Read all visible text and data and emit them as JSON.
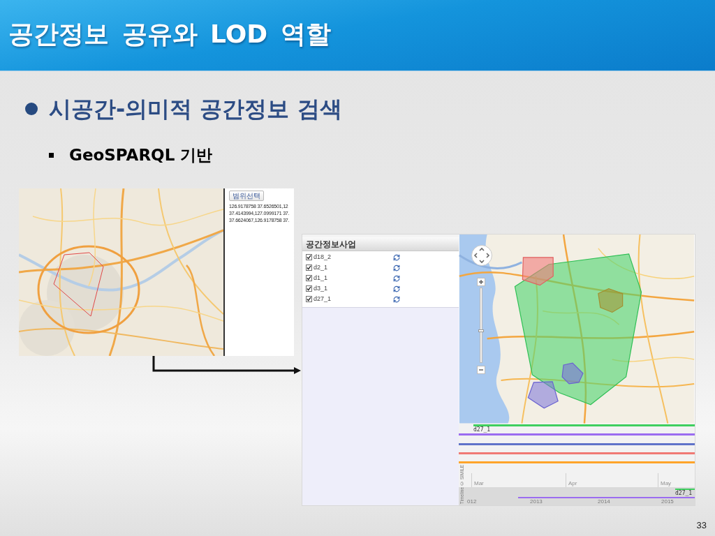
{
  "slide": {
    "title": "공간정보 공유와 LOD 역할",
    "page_number": "33"
  },
  "bullets": [
    {
      "text": "시공간-의미적 공간정보 검색",
      "children": [
        {
          "text": "GeoSPARQL 기반"
        }
      ]
    }
  ],
  "screenshot_1": {
    "button": "범위선택",
    "coordinates": [
      "126.9178758 37.6526501,12",
      "37.4143994,127.0999171 37.",
      "37.6624067,126.9178758 37."
    ]
  },
  "screenshot_2": {
    "panel_title": "공간정보사업",
    "layers": [
      {
        "label": "d18_2",
        "checked": true
      },
      {
        "label": "d2_1",
        "checked": true
      },
      {
        "label": "d1_1",
        "checked": true
      },
      {
        "label": "d3_1",
        "checked": true
      },
      {
        "label": "d27_1",
        "checked": true
      }
    ],
    "map": {
      "zoom_slider": {
        "level": 0.44
      }
    },
    "timeline": {
      "tracks": [
        {
          "label": "d27_1",
          "color": "#3fcf5f"
        },
        {
          "color": "#9b6cf0"
        },
        {
          "color": "#5f73c9"
        },
        {
          "color": "#f07a74"
        },
        {
          "color": "#ffa42a"
        }
      ],
      "months": [
        "Mar",
        "Apr",
        "May"
      ],
      "overview": {
        "label": "d27_1",
        "years": [
          "012",
          "2013",
          "2014",
          "2015"
        ]
      },
      "credit": "Timeline © SIMILE"
    }
  }
}
